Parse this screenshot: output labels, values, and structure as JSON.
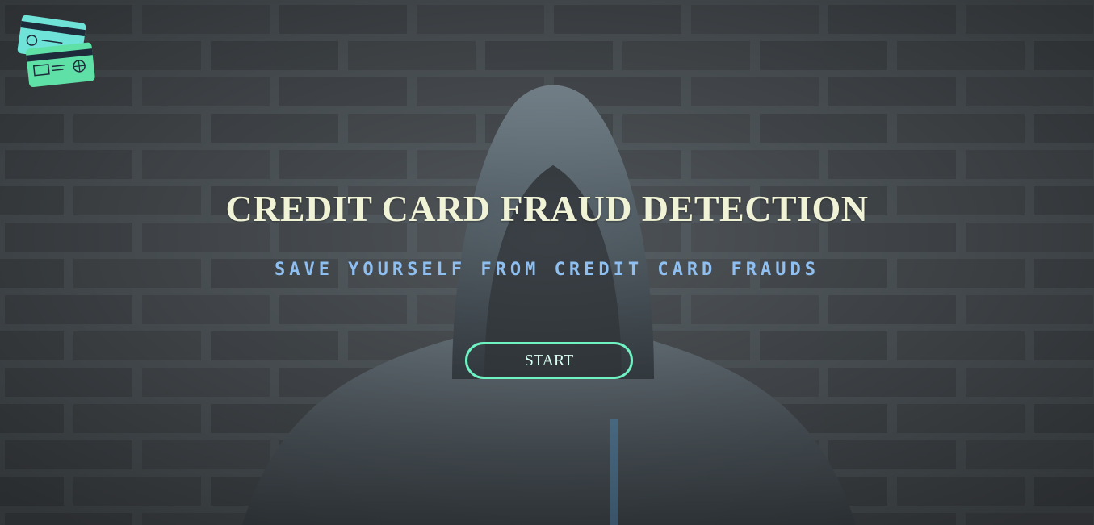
{
  "hero": {
    "title": "CREDIT CARD FRAUD DETECTION",
    "subtitle": "SAVE YOURSELF FROM CREDIT CARD FRAUDS",
    "start_label": "START"
  },
  "logo": {
    "icon": "credit-cards-icon",
    "card_colors": [
      "#6fe3d8",
      "#5fe0a6"
    ]
  },
  "colors": {
    "title": "#f1f3d6",
    "subtitle": "#8fbff0",
    "button_border": "#6ff3c3",
    "button_text": "#d9fff2"
  }
}
